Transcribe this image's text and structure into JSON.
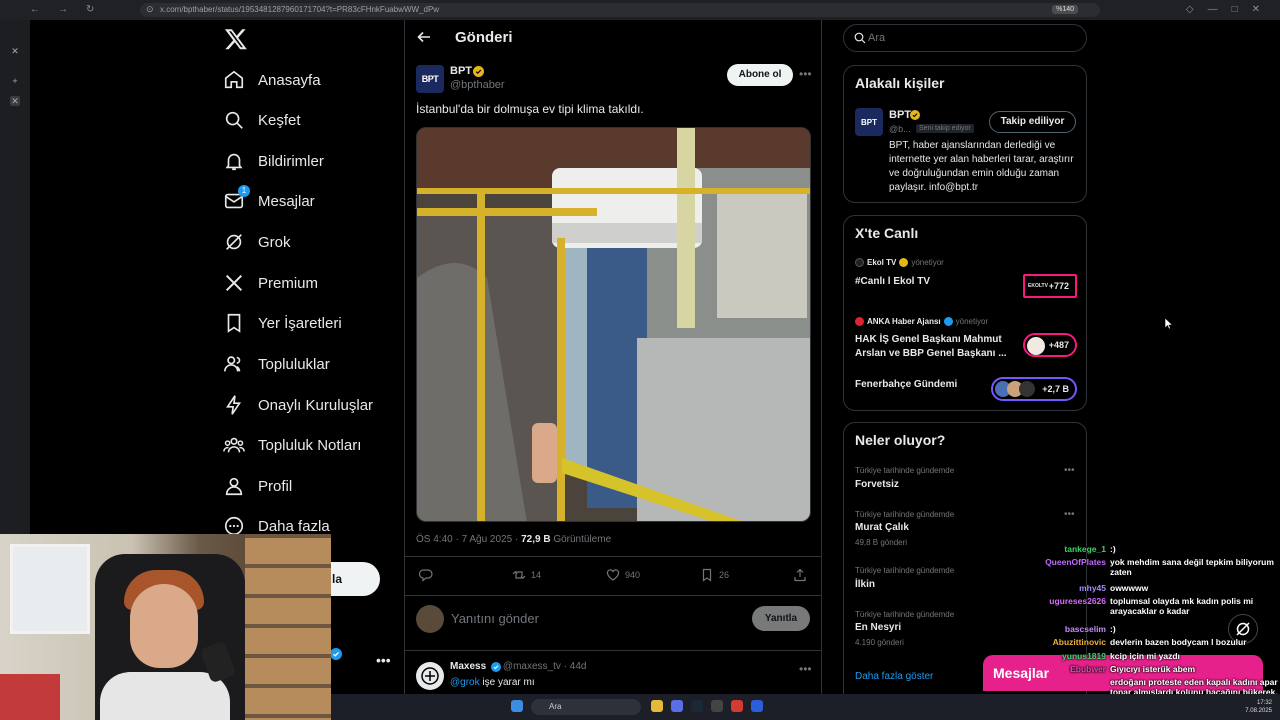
{
  "browser": {
    "url": "x.com/bpthaber/status/1953481287960171704?t=PR83cFHnkFuabwWW_dPw",
    "zoom": "%140"
  },
  "nav": {
    "items": [
      {
        "label": "Anasayfa",
        "icon": "home-icon"
      },
      {
        "label": "Keşfet",
        "icon": "search-icon"
      },
      {
        "label": "Bildirimler",
        "icon": "bell-icon"
      },
      {
        "label": "Mesajlar",
        "icon": "mail-icon",
        "badge": "1"
      },
      {
        "label": "Grok",
        "icon": "grok-icon"
      },
      {
        "label": "Premium",
        "icon": "x-logo-icon"
      },
      {
        "label": "Yer İşaretleri",
        "icon": "bookmark-icon"
      },
      {
        "label": "Topluluklar",
        "icon": "people-icon"
      },
      {
        "label": "Onaylı Kuruluşlar",
        "icon": "lightning-icon"
      },
      {
        "label": "Topluluk Notları",
        "icon": "community-notes-icon"
      },
      {
        "label": "Profil",
        "icon": "person-icon"
      },
      {
        "label": "Daha fazla",
        "icon": "more-circle-icon"
      }
    ],
    "post_button_tail": "la"
  },
  "header": {
    "title": "Gönderi"
  },
  "post": {
    "author_name": "BPT",
    "author_handle": "@bpthaber",
    "avatar_text": "BPT",
    "subscribe_label": "Abone ol",
    "text": "İstanbul'da bir dolmuşa ev tipi klima takıldı.",
    "time": "ÖS 4:40 · 7 Ağu 2025 · ",
    "views": "72,9 B",
    "views_label": " Görüntüleme",
    "replies": "",
    "reposts": "14",
    "likes": "940",
    "bookmarks": "26",
    "reply_placeholder": "Yanıtını gönder",
    "reply_button": "Yanıtla"
  },
  "comment": {
    "name": "Maxess",
    "handle": "@maxess_tv · 44d",
    "mention": "@grok",
    "text": " işe yarar mı"
  },
  "search": {
    "placeholder": "Ara"
  },
  "related": {
    "title": "Alakalı kişiler",
    "name": "BPT",
    "handle": "@b...",
    "follows_you": "Seni takip ediyor",
    "follow_button": "Takip ediliyor",
    "bio": "BPT, haber ajanslarından derlediği ve internette yer alan haberleri tarar, araştırır ve doğruluğundan emin olduğu zaman paylaşır. info@bpt.tr"
  },
  "live": {
    "title": "X'te Canlı",
    "items": [
      {
        "owner": "Ekol TV",
        "role": "yönetiyor",
        "title": "#Canlı l Ekol TV",
        "count": "+772",
        "thumb": "EKOLTV"
      },
      {
        "owner": "ANKA Haber Ajansı",
        "role": "yönetiyor",
        "title": "HAK İŞ Genel Başkanı Mahmut Arslan ve BBP Genel Başkanı ...",
        "count": "+487"
      },
      {
        "owner": "",
        "role": "",
        "title": "Fenerbahçe Gündemi",
        "count": "+2,7 B"
      }
    ]
  },
  "trends": {
    "title": "Neler oluyor?",
    "items": [
      {
        "category": "Türkiye tarihinde gündemde",
        "name": "Forvetsiz",
        "posts": ""
      },
      {
        "category": "Türkiye tarihinde gündemde",
        "name": "Murat Çalık",
        "posts": "49,8 B gönderi"
      },
      {
        "category": "Türkiye tarihinde gündemde",
        "name": "İlkin",
        "posts": ""
      },
      {
        "category": "Türkiye tarihinde gündemde",
        "name": "En Nesyri",
        "posts": "4.190 gönderi"
      }
    ],
    "show_more": "Daha fazla göster"
  },
  "chat": {
    "lines": [
      {
        "user": "tankege_1",
        "msg": ":)",
        "color": "#3fd36b"
      },
      {
        "user": "QueenOfPlates",
        "msg": "yok mehdim sana değil tepkim biliyorum zaten",
        "color": "#c06bff"
      },
      {
        "user": "mhy45",
        "msg": "owwwww",
        "color": "#a58bff"
      },
      {
        "user": "ugureses2626",
        "msg": "toplumsal olayda mk kadın polis mi arayacaklar o kadar",
        "color": "#d96bff"
      },
      {
        "user": "bascselim",
        "msg": ":)",
        "color": "#c98bff"
      },
      {
        "user": "Abuzittinovic",
        "msg": "devlerin bazen bodycam l bozulur",
        "color": "#f0b23a"
      },
      {
        "user": "yunus1819",
        "msg": "kcip için mi yazdı",
        "color": "#3fd36b"
      },
      {
        "user": "Ebubwer",
        "msg": "Gıyıcıyı isterük abem",
        "color": "#e04ab0"
      },
      {
        "user": "",
        "msg": "erdoğanı proteste eden kapalı kadını apar topar almışlardı kolunu bacağını bükerek.",
        "color": "#ffffff"
      }
    ],
    "dm_label": "Mesajlar"
  },
  "taskbar": {
    "search": "Ara",
    "time": "17:32",
    "date": "7.08.2025"
  }
}
